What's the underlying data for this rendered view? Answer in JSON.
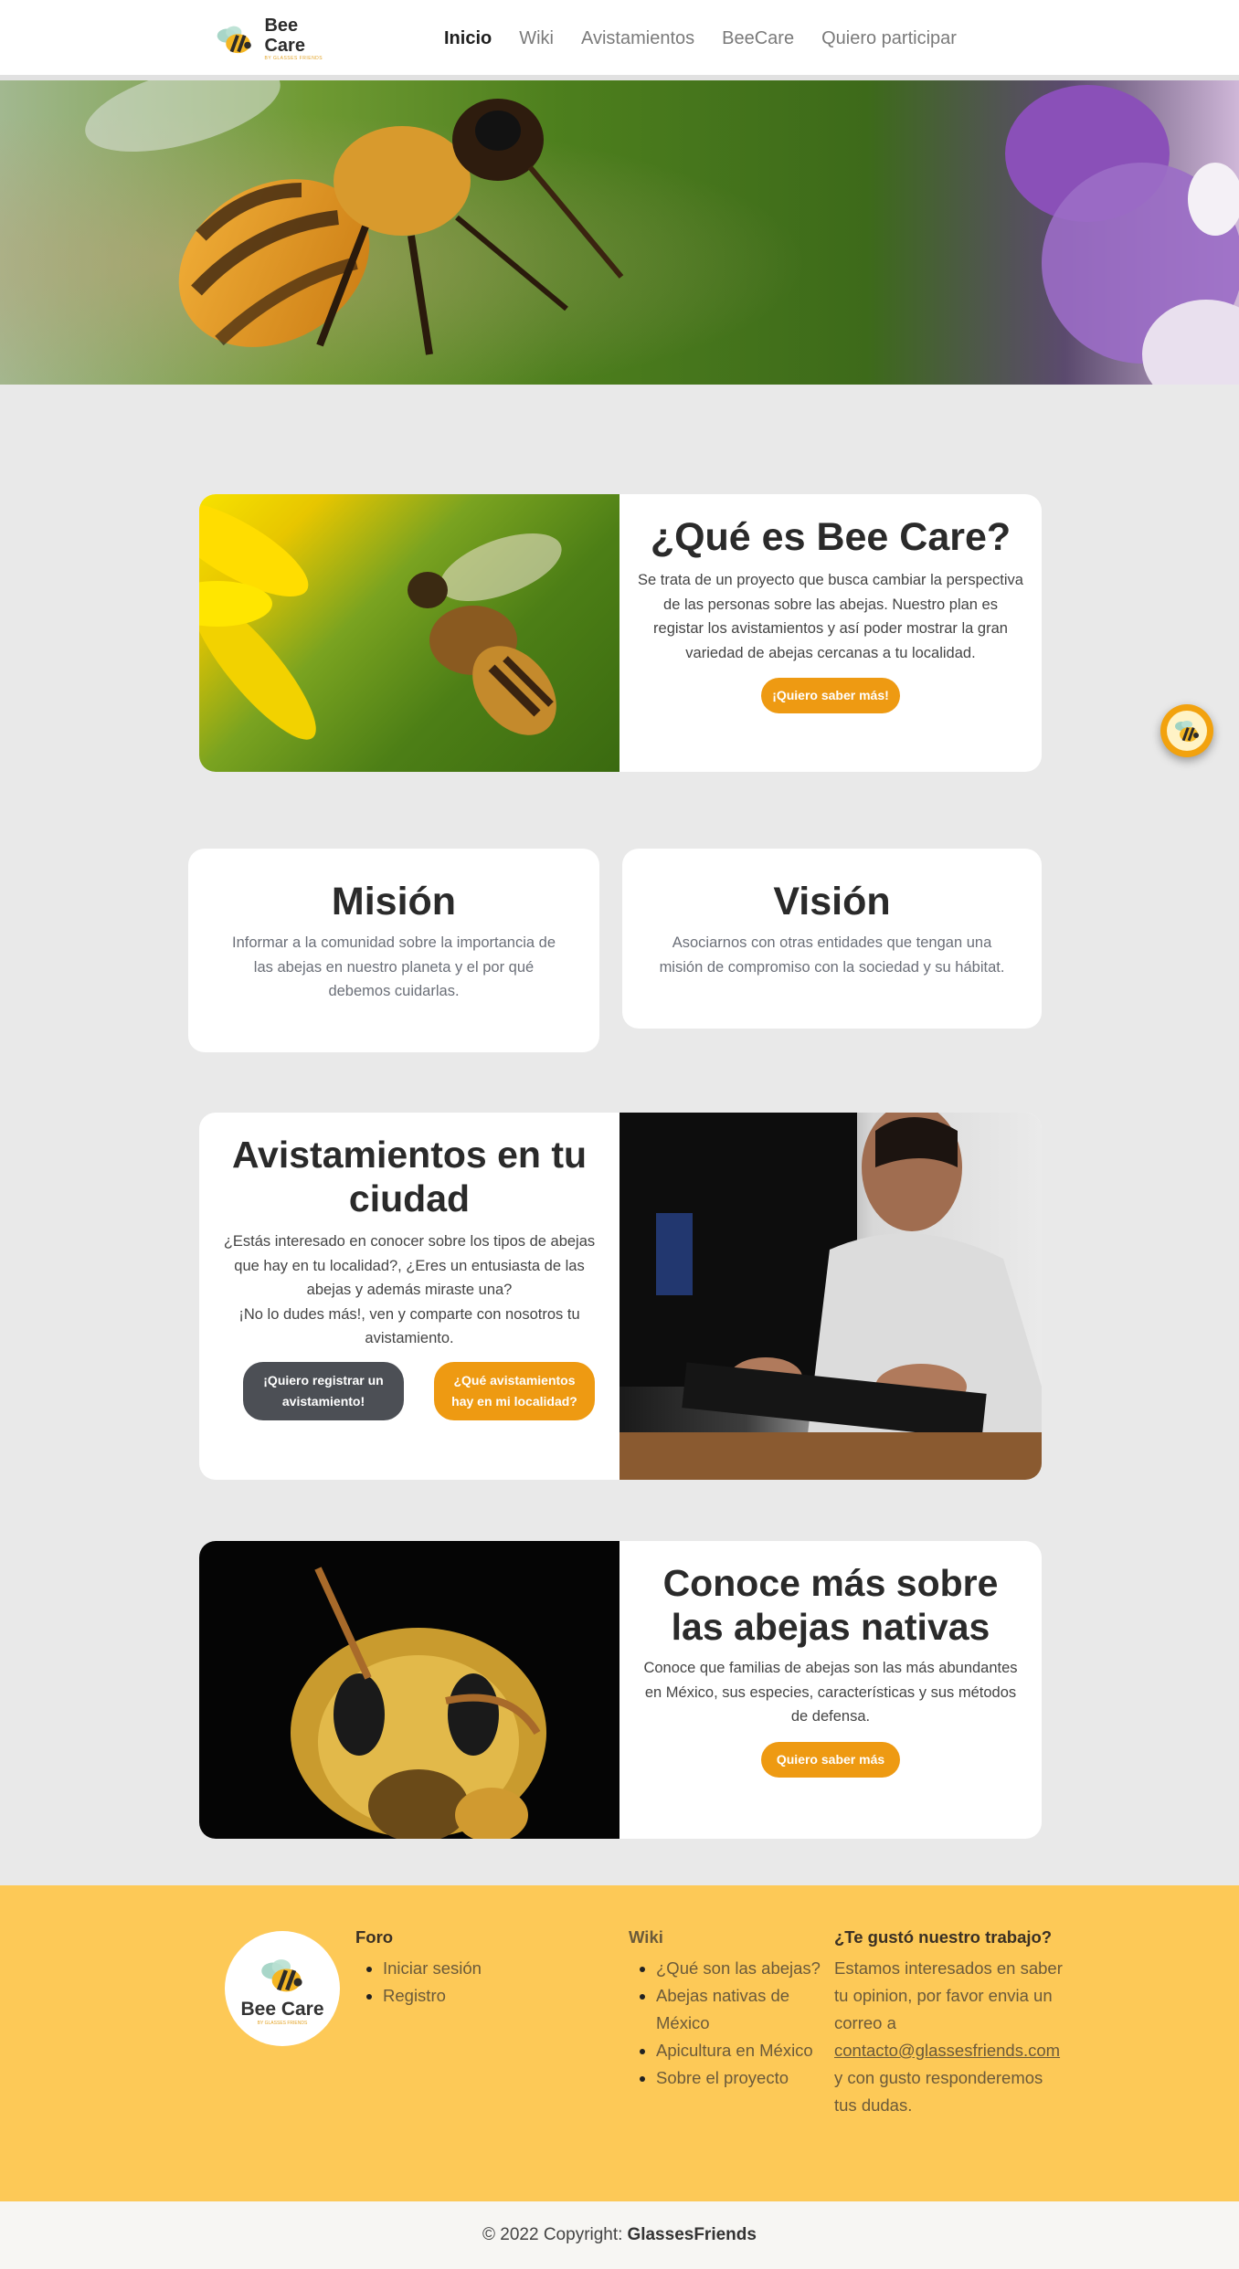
{
  "nav": {
    "brand_name": "Bee Care",
    "brand_sub": "BY GLASSES FRIENDS",
    "links": [
      "Inicio",
      "Wiki",
      "Avistamientos",
      "BeeCare",
      "Quiero participar"
    ]
  },
  "about": {
    "title": "¿Qué es Bee Care?",
    "text": "Se trata de un proyecto que busca cambiar la perspectiva de las personas sobre las abejas. Nuestro plan es registar los avistamientos y así poder mostrar la gran variedad de abejas cercanas a tu localidad.",
    "button": "¡Quiero saber más!"
  },
  "mission": {
    "title": "Misión",
    "text": "Informar a la comunidad sobre la importancia de las abejas en nuestro planeta y el por qué debemos cuidarlas."
  },
  "vision": {
    "title": "Visión",
    "text": "Asociarnos con otras entidades que tengan una misión de compromiso con la sociedad y su hábitat."
  },
  "sightings": {
    "title": "Avistamientos en tu ciudad",
    "text1": "¿Estás interesado en conocer sobre los tipos de abejas que hay en tu localidad?, ¿Eres un entusiasta de las abejas y además miraste una?",
    "text2": "¡No lo dudes más!, ven y comparte con nosotros tu avistamiento.",
    "button_register": "¡Quiero registrar un avistamiento!",
    "button_local": "¿Qué avistamientos hay en mi localidad?"
  },
  "native": {
    "title": "Conoce más sobre las abejas nativas",
    "text": "Conoce que familias de abejas son las más abundantes en México, sus especies, características y sus métodos de defensa.",
    "button": "Quiero saber más"
  },
  "footer": {
    "logo_name": "Bee Care",
    "logo_sub": "BY GLASSES FRIENDS",
    "foro": {
      "title": "Foro",
      "items": [
        "Iniciar sesión",
        "Registro"
      ]
    },
    "wiki": {
      "title": "Wiki",
      "items": [
        "¿Qué son las abejas?",
        "Abejas nativas de México",
        "Apicultura en México",
        "Sobre el proyecto"
      ]
    },
    "contact": {
      "title": "¿Te gustó nuestro trabajo?",
      "text_before": "Estamos interesados en saber tu opinion, por favor envia un correo a",
      "email": "contacto@glassesfriends.com",
      "text_after": "y con gusto responderemos tus dudas."
    }
  },
  "copyright": {
    "text": "© 2022 Copyright:",
    "owner": "GlassesFriends"
  },
  "colors": {
    "accent": "#ee9a12",
    "footer": "#fdc957",
    "dark_button": "#4c4f55",
    "background": "#e9e9e9"
  }
}
